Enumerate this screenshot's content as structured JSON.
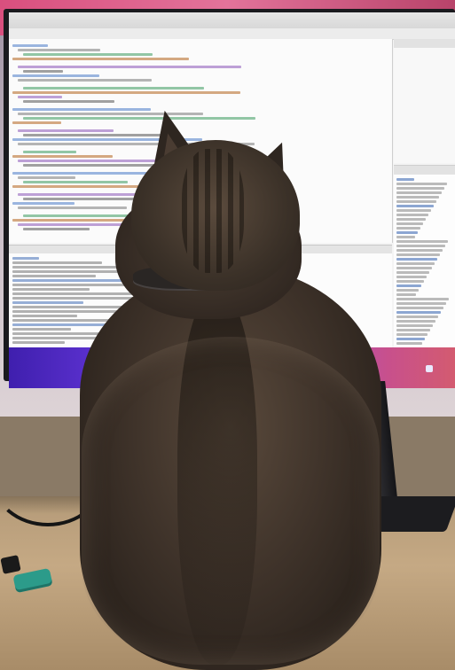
{
  "scene": {
    "subject": "cat-back-view",
    "colors": {
      "wall": "#cbbfc8",
      "wall_accent": "#d94f7e",
      "screen_bg": "#f4f4f4",
      "wallpaper_start": "#3f1fae",
      "wallpaper_end": "#d35b70",
      "desk": "#c5a984",
      "cat_fur": "#3f332a",
      "usb_stick": "#2c9b8a"
    }
  }
}
